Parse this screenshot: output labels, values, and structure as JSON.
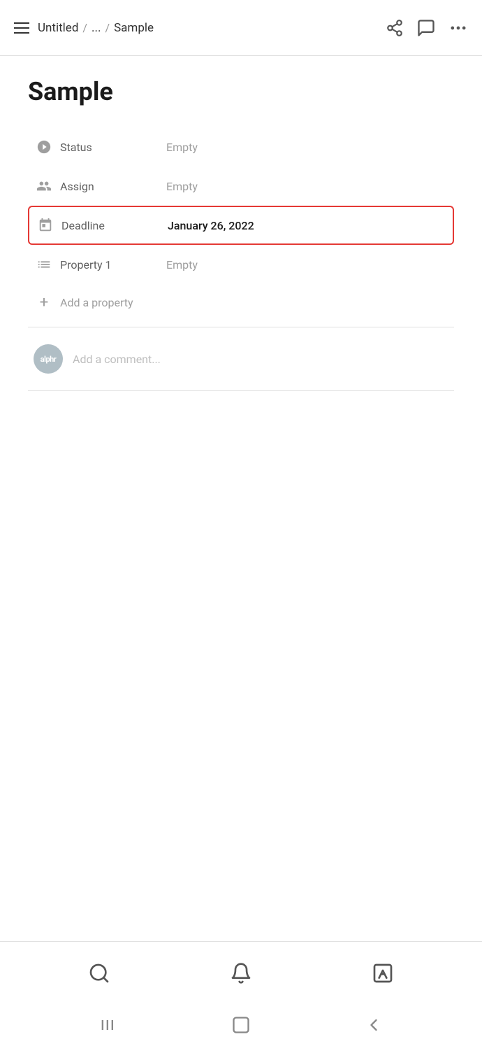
{
  "topbar": {
    "breadcrumb": {
      "root": "Untitled",
      "sep1": "/",
      "ellipsis": "...",
      "sep2": "/",
      "current": "Sample"
    }
  },
  "page": {
    "title": "Sample"
  },
  "properties": [
    {
      "id": "status",
      "icon": "status-icon",
      "label": "Status",
      "value": "Empty",
      "filled": false,
      "highlighted": false
    },
    {
      "id": "assign",
      "icon": "assign-icon",
      "label": "Assign",
      "value": "Empty",
      "filled": false,
      "highlighted": false
    },
    {
      "id": "deadline",
      "icon": "deadline-icon",
      "label": "Deadline",
      "value": "January 26, 2022",
      "filled": true,
      "highlighted": true
    },
    {
      "id": "property1",
      "icon": "list-icon",
      "label": "Property 1",
      "value": "Empty",
      "filled": false,
      "highlighted": false
    }
  ],
  "addProperty": {
    "label": "Add a property"
  },
  "comment": {
    "avatarText": "alphr",
    "placeholder": "Add a comment..."
  },
  "toolbar": {
    "search": "search-icon",
    "bell": "bell-icon",
    "edit": "edit-icon"
  },
  "androidNav": {
    "menu": "menu-icon",
    "home": "home-icon",
    "back": "back-icon"
  }
}
